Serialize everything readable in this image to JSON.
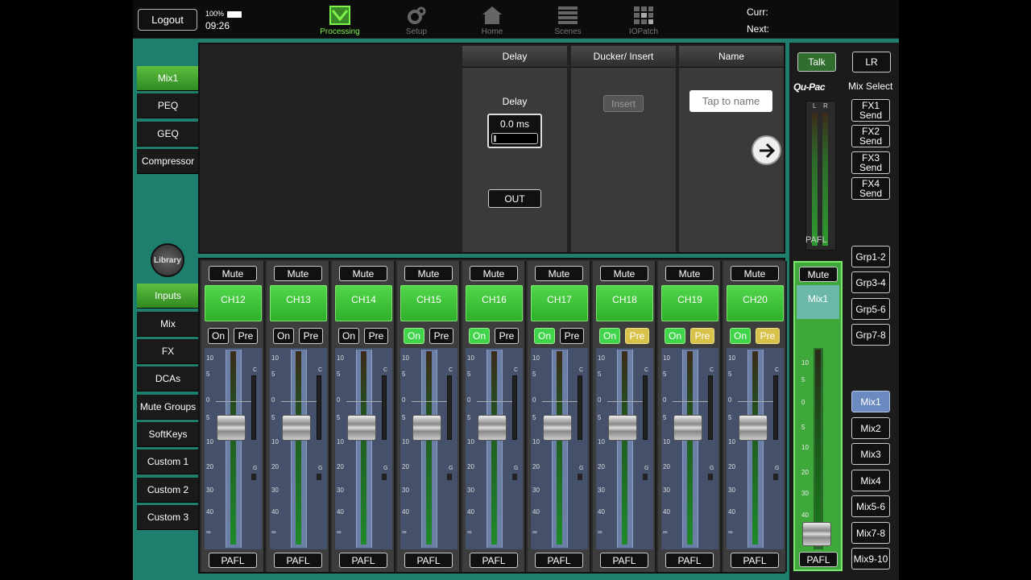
{
  "topbar": {
    "logout_label": "Logout",
    "battery": "100%",
    "time": "09:26",
    "nav": [
      {
        "label": "Processing",
        "icon": "processing-icon",
        "active": true
      },
      {
        "label": "Setup",
        "icon": "gear-icon",
        "active": false
      },
      {
        "label": "Home",
        "icon": "home-icon",
        "active": false
      },
      {
        "label": "Scenes",
        "icon": "scenes-icon",
        "active": false
      },
      {
        "label": "IOPatch",
        "icon": "grid-icon",
        "active": false
      }
    ],
    "curr_label": "Curr:",
    "next_label": "Next:"
  },
  "sidebar": {
    "processing_items": [
      {
        "label": "Mix1",
        "active": true
      },
      {
        "label": "PEQ",
        "active": false
      },
      {
        "label": "GEQ",
        "active": false
      },
      {
        "label": "Compressor",
        "active": false
      }
    ],
    "library_label": "Library",
    "layer_items": [
      {
        "label": "Inputs",
        "active": true
      },
      {
        "label": "Mix",
        "active": false
      },
      {
        "label": "FX",
        "active": false
      },
      {
        "label": "DCAs",
        "active": false
      },
      {
        "label": "Mute Groups",
        "active": false
      },
      {
        "label": "SoftKeys",
        "active": false
      },
      {
        "label": "Custom 1",
        "active": false
      },
      {
        "label": "Custom 2",
        "active": false
      },
      {
        "label": "Custom 3",
        "active": false
      }
    ]
  },
  "processing": {
    "delay": {
      "header": "Delay",
      "label": "Delay",
      "value": "0.0 ms",
      "out_label": "OUT"
    },
    "ducker": {
      "header": "Ducker/ Insert",
      "insert_label": "Insert"
    },
    "name": {
      "header": "Name",
      "placeholder": "Tap to name"
    }
  },
  "fader_scale": [
    "10",
    "5",
    "0",
    "5",
    "10",
    "20",
    "30",
    "40",
    "∞"
  ],
  "strips": [
    {
      "mute": "Mute",
      "name": "CH12",
      "on": "On",
      "on_lit": false,
      "pre": "Pre",
      "pre_lit": false,
      "pafl": "PAFL"
    },
    {
      "mute": "Mute",
      "name": "CH13",
      "on": "On",
      "on_lit": false,
      "pre": "Pre",
      "pre_lit": false,
      "pafl": "PAFL"
    },
    {
      "mute": "Mute",
      "name": "CH14",
      "on": "On",
      "on_lit": false,
      "pre": "Pre",
      "pre_lit": false,
      "pafl": "PAFL"
    },
    {
      "mute": "Mute",
      "name": "CH15",
      "on": "On",
      "on_lit": true,
      "pre": "Pre",
      "pre_lit": false,
      "pafl": "PAFL"
    },
    {
      "mute": "Mute",
      "name": "CH16",
      "on": "On",
      "on_lit": true,
      "pre": "Pre",
      "pre_lit": false,
      "pafl": "PAFL"
    },
    {
      "mute": "Mute",
      "name": "CH17",
      "on": "On",
      "on_lit": true,
      "pre": "Pre",
      "pre_lit": false,
      "pafl": "PAFL"
    },
    {
      "mute": "Mute",
      "name": "CH18",
      "on": "On",
      "on_lit": true,
      "pre": "Pre",
      "pre_lit": true,
      "pafl": "PAFL"
    },
    {
      "mute": "Mute",
      "name": "CH19",
      "on": "On",
      "on_lit": true,
      "pre": "Pre",
      "pre_lit": true,
      "pafl": "PAFL"
    },
    {
      "mute": "Mute",
      "name": "CH20",
      "on": "On",
      "on_lit": true,
      "pre": "Pre",
      "pre_lit": true,
      "pafl": "PAFL"
    }
  ],
  "strip_side_labels": {
    "c": "C",
    "g": "G"
  },
  "master": {
    "mute": "Mute",
    "name": "Mix1",
    "pafl": "PAFL",
    "scale": [
      "10",
      "5",
      "0",
      "5",
      "10",
      "20",
      "30",
      "40"
    ]
  },
  "right": {
    "talk_label": "Talk",
    "lr_label": "LR",
    "brand": "Qu-Pac",
    "mix_select_label": "Mix Select",
    "meter_l": "L",
    "meter_r": "R",
    "meter_pafl": "PAFL",
    "fx_sends": [
      "FX1 Send",
      "FX2 Send",
      "FX3 Send",
      "FX4 Send"
    ],
    "groups": [
      "Grp1-2",
      "Grp3-4",
      "Grp5-6",
      "Grp7-8"
    ],
    "mixes": [
      {
        "label": "Mix1",
        "active": true
      },
      {
        "label": "Mix2",
        "active": false
      },
      {
        "label": "Mix3",
        "active": false
      },
      {
        "label": "Mix4",
        "active": false
      },
      {
        "label": "Mix5-6",
        "active": false
      },
      {
        "label": "Mix7-8",
        "active": false
      },
      {
        "label": "Mix9-10",
        "active": false
      }
    ]
  },
  "colors": {
    "accent_green": "#3fd44a",
    "pre_yellow": "#d9c24a",
    "mix_blue": "#6c8ac0",
    "background_teal": "#1e7f6e"
  }
}
